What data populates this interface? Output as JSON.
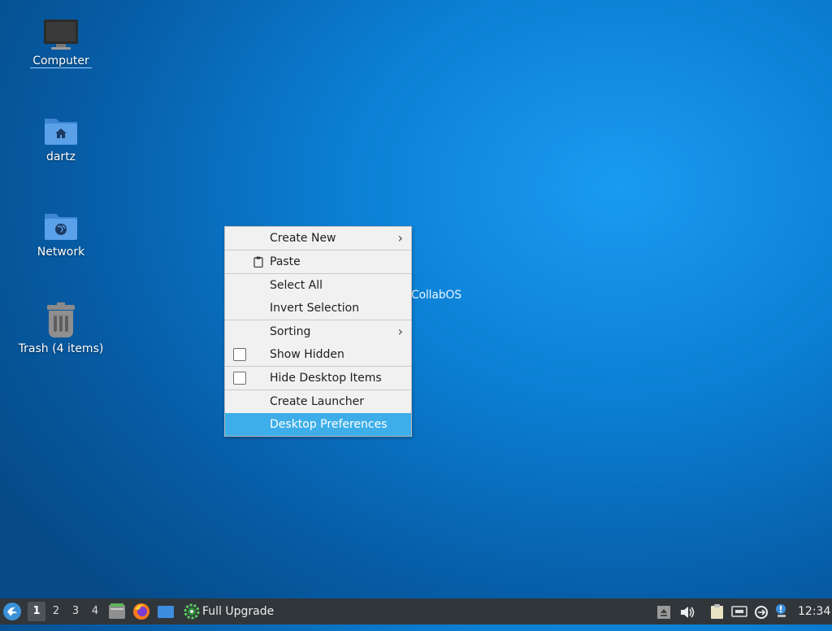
{
  "desktop": {
    "icons": [
      {
        "label": "Computer"
      },
      {
        "label": "dartz"
      },
      {
        "label": "Network"
      },
      {
        "label": "Trash (4 items)"
      }
    ],
    "wallpaper_text": "CollabOS"
  },
  "context_menu": {
    "items": [
      {
        "label": "Create New",
        "submenu": true
      },
      {
        "label": "Paste",
        "icon": "clipboard-icon"
      },
      {
        "label": "Select All"
      },
      {
        "label": "Invert Selection"
      },
      {
        "label": "Sorting",
        "submenu": true
      },
      {
        "label": "Show Hidden",
        "checkbox": true,
        "checked": false
      },
      {
        "label": "Hide Desktop Items",
        "checkbox": true,
        "checked": false
      },
      {
        "label": "Create Launcher"
      },
      {
        "label": "Desktop Preferences",
        "highlighted": true
      }
    ]
  },
  "taskbar": {
    "workspaces": [
      "1",
      "2",
      "3",
      "4"
    ],
    "active_workspace": "1",
    "task_label": "Full Upgrade",
    "clock": "12:34"
  },
  "colors": {
    "menu_highlight": "#3daee9",
    "taskbar_bg": "#31363b",
    "desktop_blue": "#0b7fd4"
  }
}
